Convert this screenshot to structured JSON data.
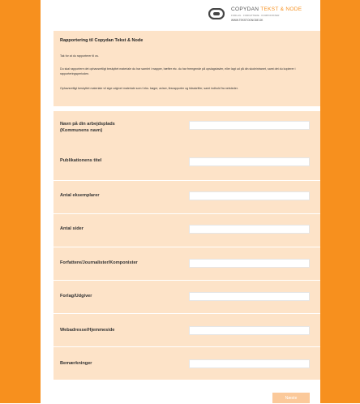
{
  "logo": {
    "brand_a": "COPYDAN",
    "brand_b": "TEKST & NODE",
    "tagline": "FORLAG · FORFATTERE · KOMPONISTER",
    "url": "WWW.TEKSTOGNODE.DK"
  },
  "intro": {
    "title": "Rapportering til Copydan Tekst & Node",
    "p1": "Tak for at du rapporterer til os.",
    "p2": "Du skal rapportere det ophavsretligt beskyttet materiale du har samlet i mapper, hæfter etc. du har fremgende på opslagstavler, eller lagt ud på din skoleintranet, samt det du kopierer i rapporteringsperioden.",
    "p3": "Ophavsretligt beskyttet materiale vil sige udgivet materiale som f.eks. bøger, aviser, årsrapporter og tidsskrifter, samt indhold fra netsteder."
  },
  "form": {
    "fields": [
      {
        "label_line1": "Navn på din arbejdsplads",
        "label_line2": "(Kommunens navn)",
        "value": ""
      },
      {
        "label_line1": "Publikationens titel",
        "label_line2": "",
        "value": ""
      },
      {
        "label_line1": "Antal eksemplarer",
        "label_line2": "",
        "value": ""
      },
      {
        "label_line1": "Antal sider",
        "label_line2": "",
        "value": ""
      },
      {
        "label_line1": "Forfattere/Journalister/Komponister",
        "label_line2": "",
        "value": ""
      },
      {
        "label_line1": "Forlag/Udgiver",
        "label_line2": "",
        "value": ""
      },
      {
        "label_line1": "Webadresse/Hjemmeside",
        "label_line2": "",
        "value": ""
      },
      {
        "label_line1": "Bemærkninger",
        "label_line2": "",
        "value": ""
      }
    ],
    "submit_label": "Næste"
  },
  "colors": {
    "accent": "#f7901e",
    "panel": "#fde3c8"
  }
}
